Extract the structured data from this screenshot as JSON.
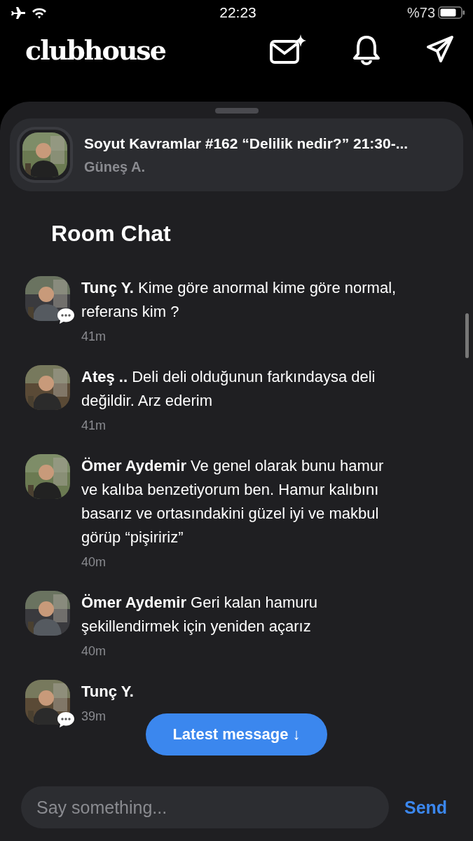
{
  "status_bar": {
    "time": "22:23",
    "battery_text": "%73"
  },
  "header": {
    "logo": "clubhouse"
  },
  "room": {
    "title": "Soyut Kavramlar #162 “Delilik nedir?” 21:30-...",
    "host": "Güneş A."
  },
  "chat": {
    "title": "Room Chat",
    "messages": [
      {
        "author": "Tunç Y.",
        "text": "Kime göre anormal kime göre normal, referans kim ?",
        "time": "41m",
        "chat_badge": true
      },
      {
        "author": "Ateş ..",
        "text": "Deli deli olduğunun farkındaysa deli değildir. Arz ederim",
        "time": "41m",
        "chat_badge": false
      },
      {
        "author": "Ömer Aydemir",
        "text": "Ve genel olarak bunu hamur ve kalıba benzetiyorum ben. Hamur kalıbını basarız ve ortasındakini güzel iyi ve makbul görüp “pişiririz”",
        "time": "40m",
        "chat_badge": false
      },
      {
        "author": "Ömer Aydemir",
        "text": "Geri kalan hamuru şekillendirmek için yeniden açarız",
        "time": "40m",
        "chat_badge": false
      },
      {
        "author": "Tunç Y.",
        "time": "39m",
        "chat_badge": true
      }
    ],
    "latest_button": "Latest message ↓"
  },
  "composer": {
    "placeholder": "Say something...",
    "send": "Send"
  }
}
